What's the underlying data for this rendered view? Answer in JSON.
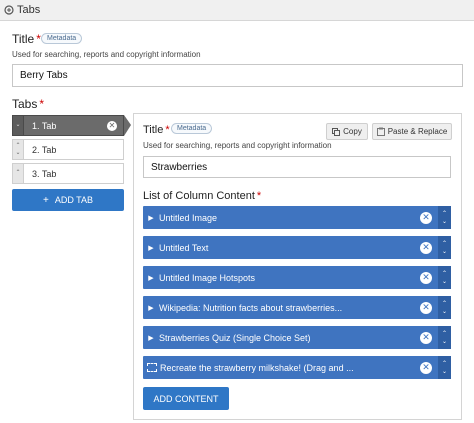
{
  "window": {
    "title": "Tabs"
  },
  "title_field": {
    "label": "Title",
    "required_mark": "*",
    "badge": "Metadata",
    "description": "Used for searching, reports and copyright information",
    "value": "Berry Tabs"
  },
  "tabs_field": {
    "label": "Tabs",
    "required_mark": "*",
    "items": [
      {
        "label": "1. Tab",
        "active": true
      },
      {
        "label": "2. Tab",
        "active": false
      },
      {
        "label": "3. Tab",
        "active": false
      }
    ],
    "add_label": "ADD TAB"
  },
  "tab_panel": {
    "title_label": "Title",
    "required_mark": "*",
    "badge": "Metadata",
    "copy_label": "Copy",
    "paste_label": "Paste & Replace",
    "description": "Used for searching, reports and copyright information",
    "title_value": "Strawberries",
    "content_label": "List of Column Content",
    "content_items": [
      "Untitled Image",
      "Untitled Text",
      "Untitled Image Hotspots",
      "Wikipedia: Nutrition facts about strawberries...",
      "Strawberries Quiz (Single Choice Set)",
      "Recreate the strawberry milkshake! (Drag and ..."
    ],
    "add_content_label": "ADD CONTENT"
  },
  "icons": {
    "window": "tabs-icon",
    "remove": "close-circle-icon",
    "expand": "chevron-right-icon",
    "reorder": "up-down-arrows-icon",
    "add": "plus-icon",
    "copy": "copy-icon",
    "paste": "paste-icon"
  },
  "colors": {
    "accent": "#2f77c6",
    "item_blue": "#3f74c0",
    "active_tab": "#6b6b6b",
    "required": "#cc0000"
  }
}
